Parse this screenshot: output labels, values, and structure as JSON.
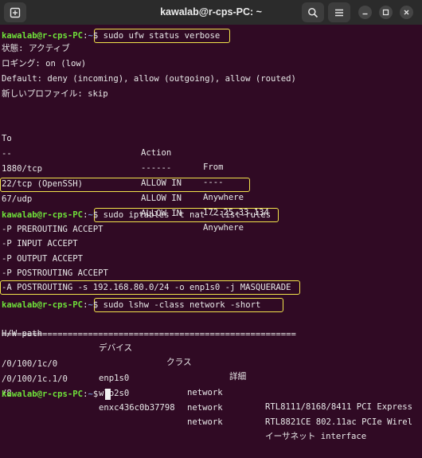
{
  "window": {
    "title": "kawalab@r-cps-PC: ~"
  },
  "prompt": {
    "user_host": "kawalab@r-cps-PC",
    "sep": ":",
    "path": "~",
    "sign": "$ "
  },
  "commands": {
    "ufw": "sudo ufw status verbose",
    "iptables": "sudo iptables -t nat --list-rules",
    "lshw": "sudo lshw -class network -short"
  },
  "ufw_output": {
    "status": "状態: アクティブ",
    "logging": "ロギング: on (low)",
    "default": "Default: deny (incoming), allow (outgoing), allow (routed)",
    "profiles": "新しいプロファイル: skip",
    "headers": [
      "To",
      "Action",
      "From"
    ],
    "dashes": [
      "--",
      "------",
      "----"
    ],
    "rules": [
      [
        "1880/tcp",
        "ALLOW IN",
        "Anywhere"
      ],
      [
        "22/tcp (OpenSSH)",
        "ALLOW IN",
        "172.25.33.134"
      ],
      [
        "67/udp",
        "ALLOW IN",
        "Anywhere"
      ]
    ]
  },
  "iptables_output": [
    "-P PREROUTING ACCEPT",
    "-P INPUT ACCEPT",
    "-P OUTPUT ACCEPT",
    "-P POSTROUTING ACCEPT",
    "-A POSTROUTING -s 192.168.80.0/24 -o enp1s0 -j MASQUERADE"
  ],
  "lshw_output": {
    "headers": [
      "H/W path",
      "デバイス",
      "クラス",
      "詳細"
    ],
    "separator": "==========================================================",
    "rows": [
      [
        "/0/100/1c/0",
        "enp1s0",
        "network",
        "RTL8111/8168/8411 PCI Express"
      ],
      [
        "/0/100/1c.1/0",
        "wlp2s0",
        "network",
        "RTL8821CE 802.11ac PCIe Wirel"
      ],
      [
        "/8",
        "enxc436c0b37798",
        "network",
        "イーサネット interface"
      ]
    ]
  }
}
